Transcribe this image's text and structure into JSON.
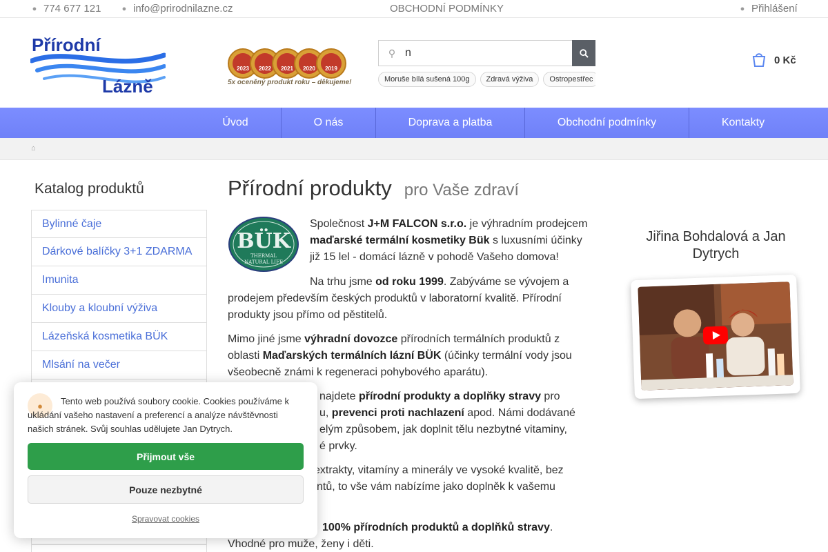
{
  "topbar": {
    "phone": "774 677 121",
    "phone_icon": "phone-icon",
    "email": "info@prirodnilazne.cz",
    "email_icon": "envelope-icon",
    "terms_link": "OBCHODNÍ PODMÍNKY",
    "login": "Přihlášení",
    "login_icon": "user-icon"
  },
  "header": {
    "logo_line1": "Přírodní",
    "logo_line2": "Lázně",
    "award_years": [
      "2023",
      "2022",
      "2021",
      "2020",
      "2019"
    ],
    "award_caption": "5x oceněný produkt roku – děkujeme!",
    "search": {
      "value": "n",
      "icon": "search-icon"
    },
    "tags": [
      "Moruše bílá sušená 100g",
      "Zdravá výživa",
      "Ostropestřec"
    ],
    "cart": {
      "icon": "cart-icon",
      "price": "0 Kč"
    }
  },
  "nav": {
    "items": [
      "Úvod",
      "O nás",
      "Doprava a platba",
      "Obchodní podmínky",
      "Kontakty"
    ]
  },
  "breadcrumb": {
    "home_icon": "home-icon"
  },
  "sidebar": {
    "title": "Katalog produktů",
    "categories": [
      "Bylinné čaje",
      "Dárkové balíčky 3+1 ZDARMA",
      "Imunita",
      "Klouby a kloubní výživa",
      "Lázeňská kosmetika BÜK",
      "Mlsání na večer"
    ]
  },
  "main": {
    "title": "Přírodní produkty",
    "subtitle": "pro Vaše zdraví",
    "buk_logo": {
      "name": "BÜK",
      "line1": "THERMAL",
      "line2": "NATURAL LIFE"
    },
    "p1": {
      "a": "Společnost ",
      "b": "J+M FALCON s.r.o.",
      "c": " je výhradním prodejcem ",
      "d": "maďarské termální kosmetiky Bük",
      "e": " s luxusními účinky již 15 lel - domácí lázně v pohodě Vašeho domova!"
    },
    "p2": {
      "a": "Na trhu jsme ",
      "b": "od roku 1999",
      "c": ". Zabýváme se vývojem a prodejem především českých produktů v laboratorní kvalitě. Přírodní produkty jsou přímo od pěstitelů."
    },
    "p3": {
      "a": "Mimo jiné jsme ",
      "b": "výhradní dovozce",
      "c": " přírodních termálních produktů z oblasti ",
      "d": "Maďarských termálních lázní BÜK",
      "e": " (účinky termální vody jsou všeobecně známi k regeneraci pohybového aparátu)."
    },
    "p4": {
      "a": "najdete ",
      "b": "přírodní produkty a doplňky stravy",
      "c": " pro",
      "d": "u, ",
      "e": "prevenci proti nachlazení",
      "f": " apod. Námi dodávané",
      "g": "elým způsobem, jak doplnit tělu nezbytné vitaminy,",
      "h": "é prvky."
    },
    "p5": {
      "a": "extrakty, vitamíny a minerály ve vysoké kvalitě, bez",
      "b": "ntů, to vše vám nabízíme jako doplněk k vašemu"
    },
    "p6": {
      "a": "100% přírodních produktů a doplňků stravy",
      "b": ".",
      "c": "Vhodné pro muže, ženy i děti."
    }
  },
  "video": {
    "title": "Jiřina Bohdalová a Jan Dytrych",
    "play_icon": "youtube-play-icon"
  },
  "cookie": {
    "icon": "cookie-icon",
    "text": "Tento web používá soubory cookie. Cookies používáme k ukládání vašeho nastavení a preferencí a analýze návštěvnosti našich stránek. Svůj souhlas udělujete Jan Dytrych.",
    "accept": "Přijmout vše",
    "necessary": "Pouze nezbytné",
    "manage": "Spravovat cookies"
  },
  "colors": {
    "nav_bg": "#7383fb",
    "link": "#4a6fd8",
    "accept": "#2e9e4a",
    "logo_blue": "#1e3aa8"
  }
}
